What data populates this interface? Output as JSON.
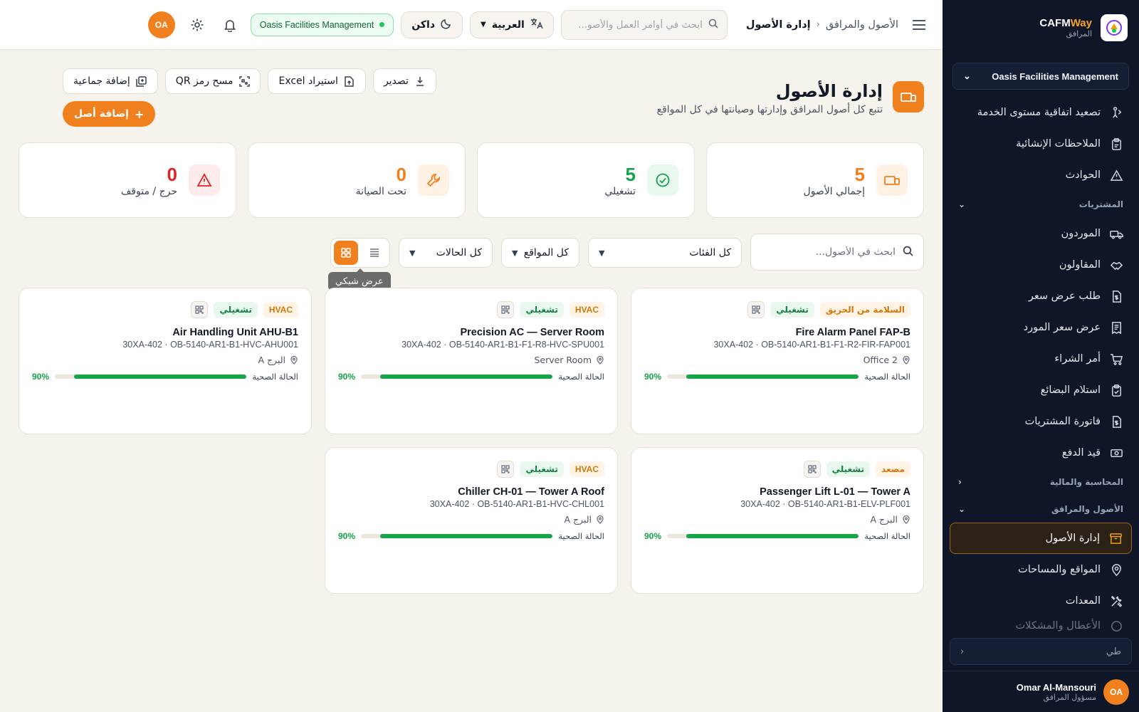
{
  "sidebar": {
    "brand_name_main": "CAFM",
    "brand_name_accent": "Way",
    "brand_sub": "المرافق",
    "org_selector": "Oasis Facilities Management",
    "items_top": [
      {
        "label": "تصعيد اتفاقية مستوى الخدمة",
        "icon": "escalation-icon"
      },
      {
        "label": "الملاحظات الإنشائية",
        "icon": "clipboard-icon"
      },
      {
        "label": "الحوادث",
        "icon": "warning-icon"
      }
    ],
    "section_procurement": "المشتريات",
    "items_procurement": [
      {
        "label": "الموردون",
        "icon": "truck-icon"
      },
      {
        "label": "المقاولون",
        "icon": "handshake-icon"
      },
      {
        "label": "طلب عرض سعر",
        "icon": "document-dollar-icon"
      },
      {
        "label": "عرض سعر المورد",
        "icon": "receipt-icon"
      },
      {
        "label": "أمر الشراء",
        "icon": "cart-icon"
      },
      {
        "label": "استلام البضائع",
        "icon": "clipboard-check-icon"
      },
      {
        "label": "فاتورة المشتريات",
        "icon": "invoice-icon"
      },
      {
        "label": "قيد الدفع",
        "icon": "cash-icon"
      }
    ],
    "section_accounting": "المحاسبة والمالية",
    "section_assets": "الأصول والمرافق",
    "items_assets": [
      {
        "label": "إدارة الأصول",
        "icon": "archive-icon"
      },
      {
        "label": "المواقع والمساحات",
        "icon": "map-pin-icon"
      },
      {
        "label": "المعدات",
        "icon": "tools-icon"
      },
      {
        "label": "الأعطال والمشكلات",
        "icon": "alert-icon"
      }
    ],
    "collapse_label": "طي",
    "user": {
      "initials": "OA",
      "name": "Omar Al-Mansouri",
      "role": "مسؤول المرافق"
    }
  },
  "header": {
    "breadcrumb_parent": "الأصول والمرافق",
    "breadcrumb_current": "إدارة الأصول",
    "search_placeholder": "ابحث في أوامر العمل والأصو...",
    "language": "العربية",
    "theme": "داكن",
    "org_badge": "Oasis Facilities Management",
    "user_initials": "OA"
  },
  "page": {
    "title": "إدارة الأصول",
    "subtitle": "تتبع كل أصول المرافق وإدارتها وصيانتها في كل المواقع",
    "actions": {
      "export": "تصدير",
      "import": "استيراد Excel",
      "scan_qr": "مسح رمز QR",
      "bulk_add": "إضافة جماعية",
      "add_asset": "إضافة أصل"
    }
  },
  "stats": [
    {
      "value": "5",
      "label": "إجمالي الأصول",
      "color": "#f07f1e",
      "bg": "#fff1e3",
      "icon": "devices-icon"
    },
    {
      "value": "5",
      "label": "تشغيلي",
      "color": "#16a34a",
      "bg": "#e8f8ee",
      "icon": "check-circle-icon"
    },
    {
      "value": "0",
      "label": "تحت الصيانة",
      "color": "#f07f1e",
      "bg": "#fff1e3",
      "icon": "wrench-icon"
    },
    {
      "value": "0",
      "label": "حرج / متوقف",
      "color": "#dc2626",
      "bg": "#fdeaea",
      "icon": "warning-triangle-icon"
    }
  ],
  "filters": {
    "search_placeholder": "ابحث في الأصول...",
    "category": "كل الفئات",
    "location": "كل المواقع",
    "status": "كل الحالات",
    "tooltip": "عرض شبكي"
  },
  "health_label": "الحالة الصحية",
  "assets": [
    {
      "category": "السلامة من الحريق",
      "status": "تشغيلي",
      "name": "Fire Alarm Panel FAP-B",
      "code": "OB-5140-AR1-B1-F1-R2-FIR-FAP001",
      "model": "30XA-402",
      "location": "Office 2",
      "health": 90,
      "health_text": "90%"
    },
    {
      "category": "HVAC",
      "status": "تشغيلي",
      "name": "Precision AC — Server Room",
      "code": "OB-5140-AR1-B1-F1-R8-HVC-SPU001",
      "model": "30XA-402",
      "location": "Server Room",
      "health": 90,
      "health_text": "90%"
    },
    {
      "category": "HVAC",
      "status": "تشغيلي",
      "name": "Air Handling Unit AHU-B1",
      "code": "OB-5140-AR1-B1-HVC-AHU001",
      "model": "30XA-402",
      "location": "البرج A",
      "health": 90,
      "health_text": "90%"
    },
    {
      "category": "مصعد",
      "status": "تشغيلي",
      "name": "Passenger Lift L-01 — Tower A",
      "code": "OB-5140-AR1-B1-ELV-PLF001",
      "model": "30XA-402",
      "location": "البرج A",
      "health": 90,
      "health_text": "90%"
    },
    {
      "category": "HVAC",
      "status": "تشغيلي",
      "name": "Chiller CH-01 — Tower A Roof",
      "code": "OB-5140-AR1-B1-HVC-CHL001",
      "model": "30XA-402",
      "location": "البرج A",
      "health": 90,
      "health_text": "90%"
    }
  ]
}
